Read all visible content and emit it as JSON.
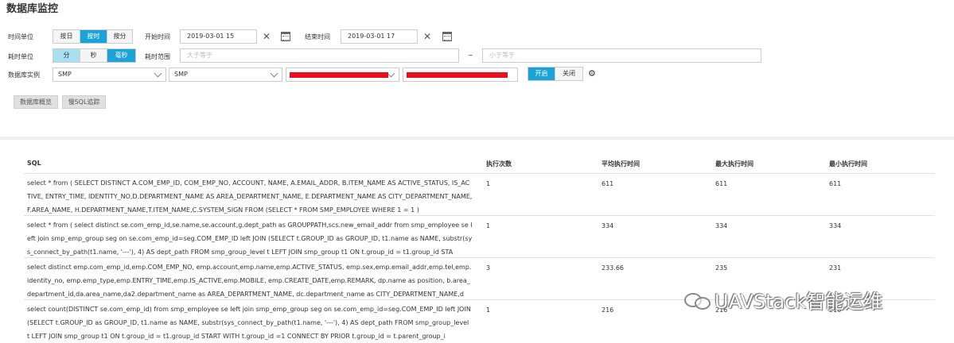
{
  "page": {
    "title": "数据库监控"
  },
  "filters": {
    "time_unit_label": "时间单位",
    "time_unit_options": [
      "按日",
      "按时",
      "按分"
    ],
    "time_unit_selected": "按时",
    "start_label": "开始时间",
    "start_value": "2019-03-01 15",
    "end_label": "结束时间",
    "end_value": "2019-03-01 17",
    "duration_unit_label": "耗时单位",
    "duration_unit_options": [
      "分",
      "秒",
      "毫秒"
    ],
    "duration_unit_selected": "毫秒",
    "range_label": "耗时范围",
    "range_min_placeholder": "大于等于",
    "range_sep": "~",
    "range_max_placeholder": "小于等于",
    "instance_label": "数据库实例",
    "instance_select_1": "SMP",
    "instance_select_2": "SMP",
    "switch_on": "开启",
    "switch_off": "关闭"
  },
  "actions": {
    "overview": "数据库概览",
    "slow_sql": "慢SQL追踪"
  },
  "table": {
    "headers": [
      "SQL",
      "执行次数",
      "平均执行时间",
      "最大执行时间",
      "最小执行时间"
    ],
    "rows": [
      {
        "sql": "select * from ( SELECT DISTINCT A.COM_EMP_ID, COM_EMP_NO, ACCOUNT, NAME, A.EMAIL_ADDR, B.ITEM_NAME AS ACTIVE_STATUS, IS_ACTIVE, ENTRY_TIME, IDENTITY_NO,D.DEPARTMENT_NAME AS AREA_DEPARTMENT_NAME, E.DEPARTMENT_NAME AS CITY_DEPARTMENT_NAME, F.AREA_NAME, H.DEPARTMENT_NAME,T.ITEM_NAME,C.SYSTEM_SIGN FROM (SELECT * FROM SMP_EMPLOYEE WHERE 1 = 1 )",
        "count": "1",
        "avg": "611",
        "max": "611",
        "min": "611"
      },
      {
        "sql": "select * from ( select distinct se.com_emp_id,se.name,se.account,g.dept_path as GROUPPATH,scs.new_email_addr from smp_employee se left join smp_emp_group seg on se.com_emp_id=seg.COM_EMP_ID left JOIN (SELECT t.GROUP_ID as GROUP_ID, t1.name as NAME, substr(sys_connect_by_path(t1.name, '---'), 4) AS dept_path FROM smp_group_level t LEFT JOIN smp_group t1 ON t.group_id = t1.group_id STA",
        "count": "1",
        "avg": "334",
        "max": "334",
        "min": "334"
      },
      {
        "sql": "select distinct emp.com_emp_id,emp.COM_EMP_NO, emp.account,emp.name,emp.ACTIVE_STATUS, emp.sex,emp.email_addr,emp.tel,emp.identity_no, emp.emp_type,emp.ENTRY_TIME,emp.IS_ACTIVE,emp.MOBILE, emp.CREATE_DATE,emp.REMARK, dp.name as position, b.area_department_id,da.area_name,da2.department_name as AREA_DEPARTMENT_NAME, dc.department_name as CITY_DEPARTMENT_NAME,d",
        "count": "3",
        "avg": "233.66",
        "max": "235",
        "min": "231"
      },
      {
        "sql": "select count(DISTINCT se.com_emp_id) from smp_employee se left join smp_emp_group seg on se.com_emp_id=seg.COM_EMP_ID left JOIN (SELECT t.GROUP_ID as GROUP_ID, t1.name as NAME, substr(sys_connect_by_path(t1.name, '---'), 4) AS dept_path FROM smp_group_level t LEFT JOIN smp_group t1 ON t.group_id = t1.group_id START WITH t.group_id =1 CONNECT BY PRIOR t.group_id = t.parent_group_i",
        "count": "1",
        "avg": "216",
        "max": "216",
        "min": "216"
      }
    ]
  },
  "watermark": {
    "text": "UAVStack智能运维",
    "icon": "wechat-icon"
  },
  "colors": {
    "accent": "#1ba3d8",
    "accent_light": "#a9dff0",
    "redaction": "#e8101c"
  }
}
